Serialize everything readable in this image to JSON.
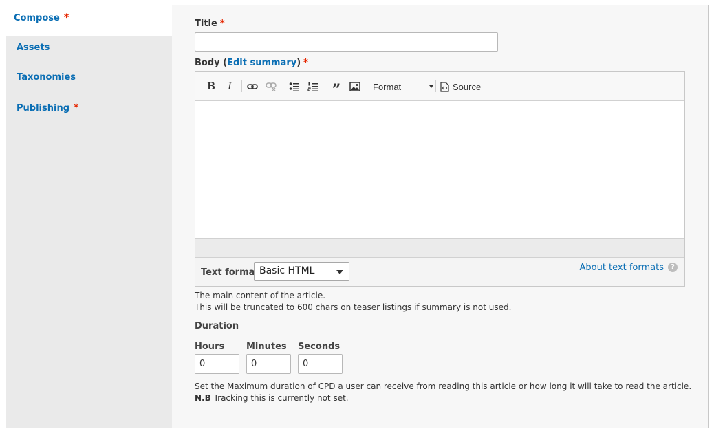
{
  "tabs": [
    {
      "label": "Compose",
      "required": true,
      "active": true
    },
    {
      "label": "Assets",
      "required": false
    },
    {
      "label": "Taxonomies",
      "required": false
    },
    {
      "label": "Publishing",
      "required": true
    }
  ],
  "required_marker": "*",
  "title_field": {
    "label": "Title",
    "value": ""
  },
  "body_field": {
    "label": "Body",
    "edit_summary_link": "Edit summary",
    "toolbar": {
      "format_label": "Format",
      "source_label": "Source",
      "icons": [
        "bold-icon",
        "italic-icon",
        "link-icon",
        "unlink-icon",
        "bulleted-list-icon",
        "numbered-list-icon",
        "blockquote-icon",
        "image-icon",
        "source-icon"
      ]
    },
    "text_format_label": "Text format",
    "text_format_value": "Basic HTML",
    "about_link": "About text formats",
    "help_glyph": "?",
    "description_line1": "The main content of the article.",
    "description_line2": "This will be truncated to 600 chars on teaser listings if summary is not used."
  },
  "duration": {
    "label": "Duration",
    "hours_label": "Hours",
    "hours_value": "0",
    "minutes_label": "Minutes",
    "minutes_value": "0",
    "seconds_label": "Seconds",
    "seconds_value": "0",
    "description": "Set the Maximum duration of CPD a user can receive from reading this article or how long it will take to read the article.",
    "note_prefix": "N.B",
    "note_text": " Tracking this is currently not set."
  },
  "colors": {
    "link": "#0a6eb4",
    "required": "#e62600"
  }
}
